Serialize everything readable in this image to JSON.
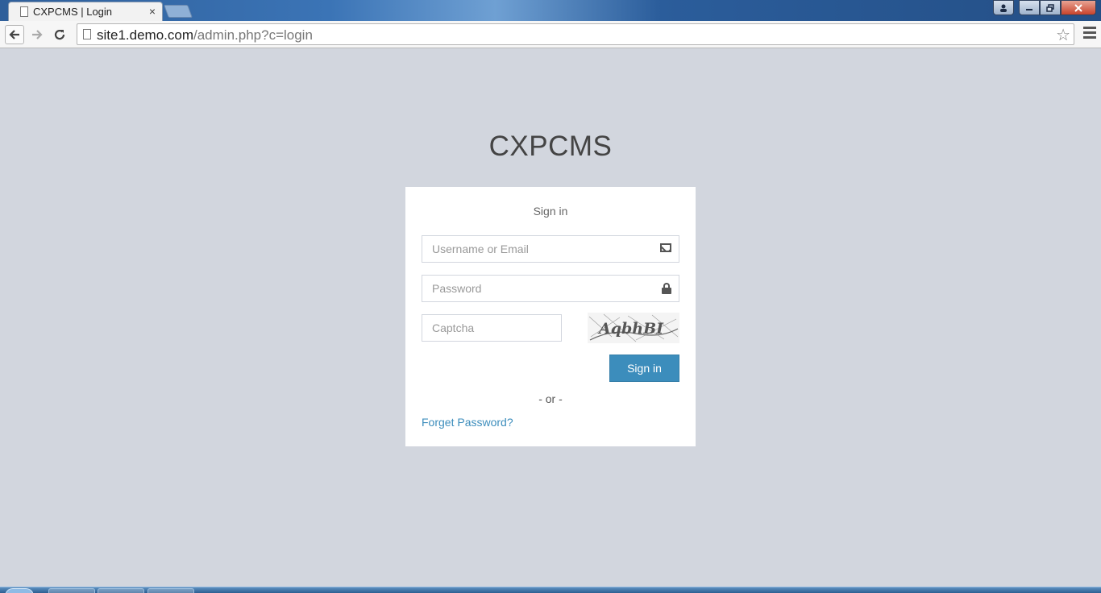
{
  "browser": {
    "tab_title": "CXPCMS | Login",
    "tab_close": "×",
    "url_host": "site1.demo.com",
    "url_path": "/admin.php?c=login",
    "window_buttons": {
      "minimize": "▬",
      "maximize": "❐",
      "close": "✕",
      "user": "👤"
    }
  },
  "page": {
    "logo": "CXPCMS",
    "login_msg": "Sign in",
    "username_placeholder": "Username or Email",
    "password_placeholder": "Password",
    "captcha_placeholder": "Captcha",
    "captcha_text": "AqbhBI",
    "signin_button": "Sign in",
    "or_text": "- or -",
    "forgot_link": "Forget Password?"
  },
  "icons": {
    "username_field": "envelope-icon",
    "password_field": "lock-icon",
    "bookmark": "star-icon",
    "menu": "hamburger-icon"
  },
  "colors": {
    "page_background": "#d2d6de",
    "primary_button": "#3c8dbc",
    "link": "#3c8dbc"
  }
}
